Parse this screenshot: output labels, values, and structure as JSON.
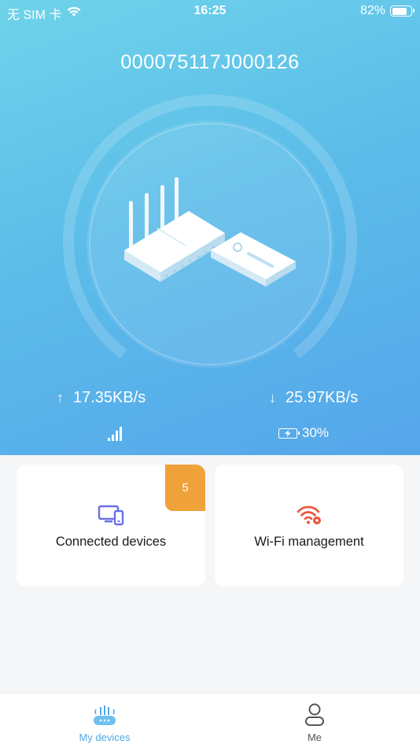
{
  "status_bar": {
    "carrier": "无 SIM 卡",
    "time": "16:25",
    "battery_text": "82%",
    "battery_level": 0.82
  },
  "device": {
    "id": "000075117J000126"
  },
  "stats": {
    "upload_speed": "17.35KB/s",
    "download_speed": "25.97KB/s",
    "battery": "30%"
  },
  "cards": {
    "connected_devices": {
      "label": "Connected devices",
      "badge": "5"
    },
    "wifi_management": {
      "label": "Wi-Fi management"
    }
  },
  "tabs": {
    "my_devices": "My devices",
    "me": "Me"
  },
  "colors": {
    "accent": "#4fa9e8",
    "badge": "#f0a23a",
    "devices_icon": "#6b6fe6",
    "wifi_icon": "#e8553a"
  },
  "icons": {
    "wifi": "wifi-icon",
    "devices": "devices-icon",
    "wifi_settings": "wifi-settings-icon",
    "router": "router-icon",
    "person": "person-icon"
  }
}
